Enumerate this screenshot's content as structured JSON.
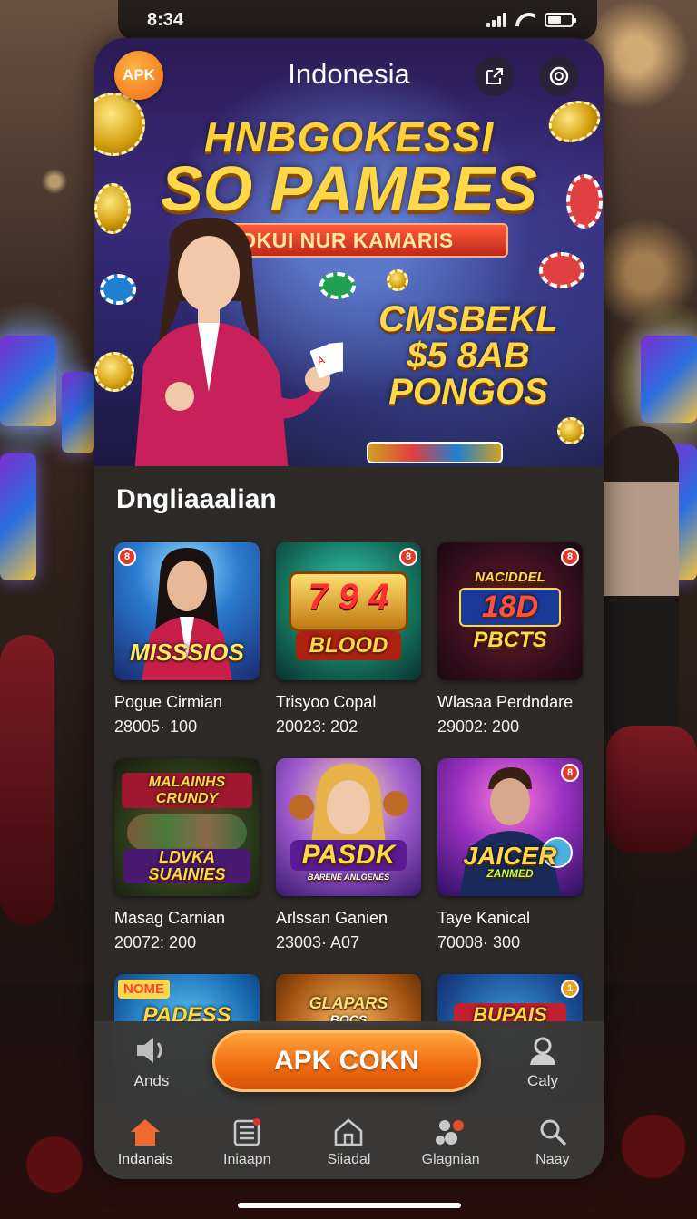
{
  "status": {
    "time": "8:34"
  },
  "header": {
    "logo": "APK",
    "title": "Indonesia"
  },
  "hero": {
    "headline_line1": "HNBGOKESSI",
    "headline_line2": "SO PAMBES",
    "ribbon": "OKUI NUR KAMARIS",
    "promo_line1": "CMSBEKL",
    "promo_line2": "$5 8AB",
    "promo_line3": "PONGOS"
  },
  "section": {
    "title": "Dngliaaalian"
  },
  "games": [
    {
      "title": "Pogue Cirmian",
      "meta": "28005· 100",
      "art": "MISSSIOS",
      "badge": "8"
    },
    {
      "title": "Trisyoo Copal",
      "meta": "20023: 202",
      "art_top": "7 9 4",
      "art": "BLOOD",
      "badge": "8"
    },
    {
      "title": "Wlasaa Perdndare",
      "meta": "29002: 200",
      "art_top": "NACIDDEL",
      "art": "18D",
      "art_bottom": "PBCTS",
      "badge": "8"
    },
    {
      "title": "Masag Carnian",
      "meta": "20072: 200",
      "art_top": "MALAINHS CRUNDY",
      "art": "LDVKA SUAINIES"
    },
    {
      "title": "Arlssan Ganien",
      "meta": "23003· A07",
      "art": "PASDK",
      "art_bottom": "BARENE ANLGENES"
    },
    {
      "title": "Taye Kanical",
      "meta": "70008· 300",
      "art": "JAICER",
      "art_bottom": "ZANMED",
      "badge": "8"
    },
    {
      "art": "PADESS",
      "art_top": "NOME"
    },
    {
      "art": "GLAPARS",
      "art_bottom": "BOCS"
    },
    {
      "art": "BUPAIS",
      "badge": "1"
    }
  ],
  "action_bar": {
    "left_label": "Ands",
    "cta": "APK COKN",
    "right_label": "Caly"
  },
  "tabs": [
    {
      "label": "Indanais",
      "icon": "home-icon"
    },
    {
      "label": "Iniaapn",
      "icon": "news-icon"
    },
    {
      "label": "Siiadal",
      "icon": "house-outline-icon"
    },
    {
      "label": "Glagnian",
      "icon": "community-icon"
    },
    {
      "label": "Naay",
      "icon": "search-icon"
    }
  ],
  "colors": {
    "accent": "#f06a10",
    "gold": "#ffd84a",
    "panel": "#2d2a28"
  }
}
